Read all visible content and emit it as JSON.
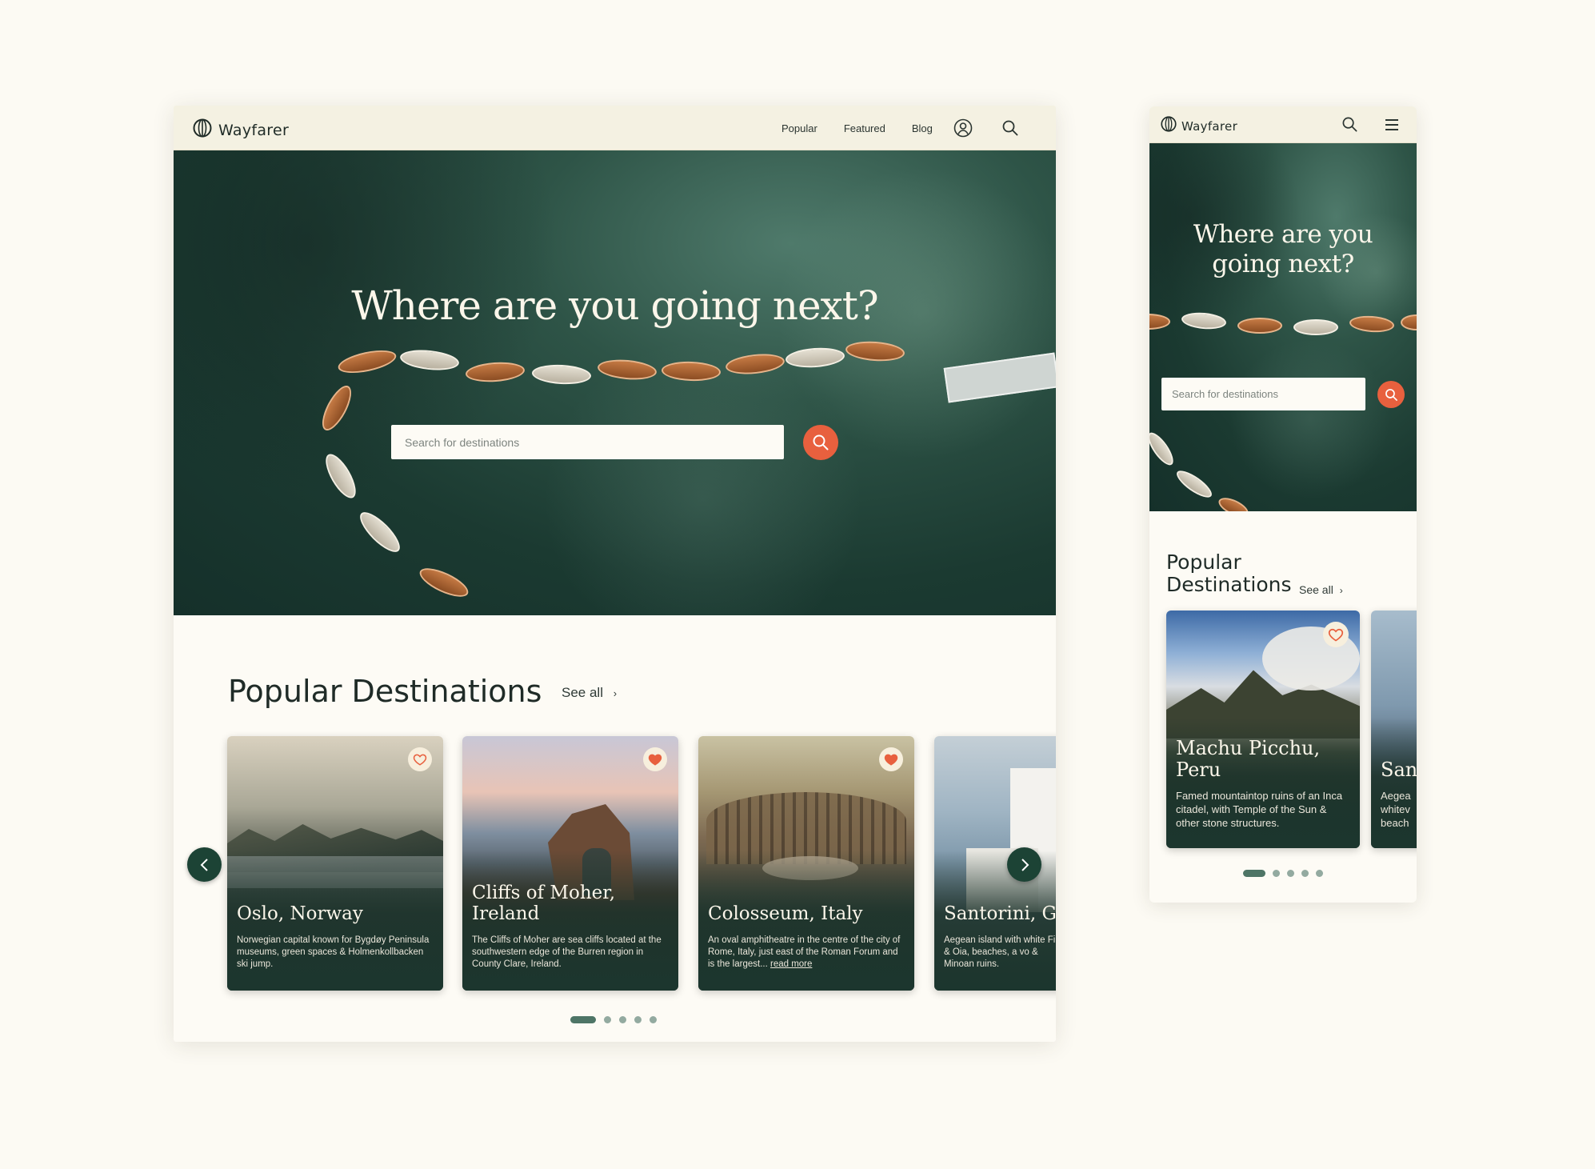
{
  "brand": {
    "name": "Wayfarer"
  },
  "desktop": {
    "nav": {
      "links": [
        "Popular",
        "Featured",
        "Blog"
      ]
    },
    "hero": {
      "title": "Where are you going next?",
      "search_placeholder": "Search for destinations"
    },
    "popular": {
      "title": "Popular Destinations",
      "see_all": "See all"
    },
    "cards": [
      {
        "title_line1": "Oslo, Norway",
        "title_line2": "",
        "description": "Norwegian capital known for Bygdøy Peninsula museums, green spaces & Holmenkollbacken ski jump.",
        "favorited": false
      },
      {
        "title_line1": "Cliffs of Moher,",
        "title_line2": "Ireland",
        "description": "The Cliffs of Moher are sea cliffs located at the southwestern edge of the Burren region in County Clare, Ireland.",
        "favorited": true
      },
      {
        "title_line1": "Colosseum, Italy",
        "title_line2": "",
        "description": "An oval amphitheatre in the centre of the city of Rome, Italy, just east of the Roman Forum and is the largest...",
        "read_more": "read more",
        "favorited": true
      },
      {
        "title_line1": "Santorini, Gr",
        "title_line2": "",
        "description": "Aegean island with white Fira & Oia, beaches, a vo & Minoan ruins.",
        "favorited": false
      }
    ],
    "pagination": {
      "pages": 5,
      "active": 1
    }
  },
  "mobile": {
    "hero": {
      "title_line1": "Where are you",
      "title_line2": "going next?",
      "search_placeholder": "Search for destinations"
    },
    "popular": {
      "title_line1": "Popular",
      "title_line2": "Destinations",
      "see_all": "See all"
    },
    "cards": [
      {
        "title_line1": "Machu Picchu,",
        "title_line2": "Peru",
        "description": "Famed mountaintop ruins of an Inca citadel, with Temple of the Sun & other stone structures.",
        "favorited": false
      },
      {
        "title_line1": "San",
        "title_line2": "",
        "description": "Aegea whitev beach",
        "favorited": false
      }
    ],
    "pagination": {
      "pages": 5,
      "active": 1
    }
  },
  "colors": {
    "accent": "#e8603e",
    "dark_green": "#1c4335",
    "background": "#fcfaf3",
    "nav_bg": "#f4f1e2"
  },
  "icons": [
    "globe-icon",
    "account-icon",
    "search-icon",
    "menu-icon",
    "heart-icon",
    "chevron-left-icon",
    "chevron-right-icon"
  ]
}
